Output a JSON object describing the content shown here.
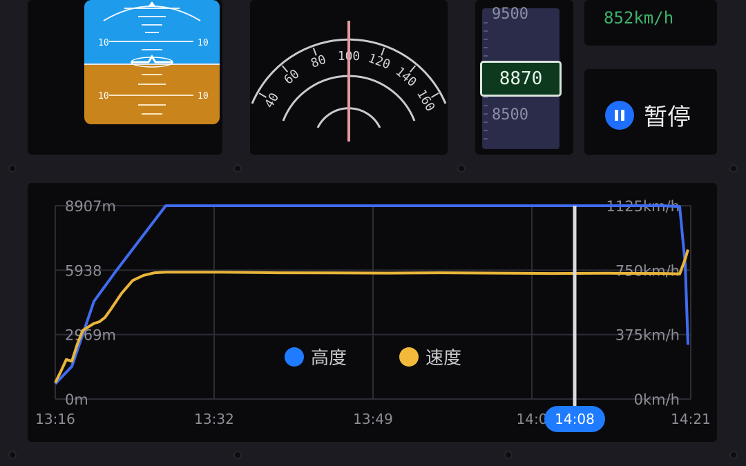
{
  "attitude_indicator": {
    "pitch_marks": [
      "10",
      "10",
      "10",
      "10"
    ],
    "sky_color": "#1e9bea",
    "ground_color": "#c9841c"
  },
  "heading_dial": {
    "ticks": [
      "40",
      "60",
      "80",
      "100",
      "120",
      "140",
      "160"
    ]
  },
  "altitude_tape": {
    "upper": "9500",
    "current": "8870",
    "lower": "8500"
  },
  "speed_display": {
    "value": "852km/h"
  },
  "playback": {
    "pause_label": "暂停"
  },
  "chart_data": {
    "type": "line",
    "x_ticks": [
      "13:16",
      "13:32",
      "13:49",
      "14:0",
      "14:21"
    ],
    "cursor_time": "14:08",
    "y_left_ticks": [
      "8907m",
      "5938",
      "2969m",
      "0m"
    ],
    "y_right_ticks": [
      "1125km/h",
      "750km/h",
      "375km/h",
      "0km/h"
    ],
    "ylim_left": [
      0,
      8907
    ],
    "ylim_right": [
      0,
      1125
    ],
    "series": [
      {
        "name": "高度",
        "color": "#3f6cf0",
        "points": [
          [
            0,
            700
          ],
          [
            3,
            1500
          ],
          [
            7,
            4500
          ],
          [
            11,
            5900
          ],
          [
            20,
            8907
          ],
          [
            60,
            8907
          ],
          [
            100,
            8907
          ],
          [
            110,
            8907
          ],
          [
            113,
            8870
          ],
          [
            114,
            6200
          ],
          [
            114.5,
            2500
          ]
        ]
      },
      {
        "name": "速度",
        "color": "#e8b53a",
        "points": [
          [
            0,
            95
          ],
          [
            1,
            160
          ],
          [
            2,
            230
          ],
          [
            3,
            220
          ],
          [
            4,
            320
          ],
          [
            5,
            400
          ],
          [
            6,
            420
          ],
          [
            7,
            440
          ],
          [
            8,
            450
          ],
          [
            9,
            475
          ],
          [
            10,
            520
          ],
          [
            12,
            615
          ],
          [
            14,
            690
          ],
          [
            16,
            720
          ],
          [
            18,
            735
          ],
          [
            20,
            738
          ],
          [
            30,
            738
          ],
          [
            40,
            735
          ],
          [
            50,
            734
          ],
          [
            60,
            733
          ],
          [
            70,
            735
          ],
          [
            80,
            733
          ],
          [
            90,
            731
          ],
          [
            100,
            732
          ],
          [
            110,
            731
          ],
          [
            113,
            728
          ],
          [
            114,
            815
          ],
          [
            114.5,
            870
          ]
        ]
      }
    ],
    "xlim": [
      0,
      115
    ]
  }
}
